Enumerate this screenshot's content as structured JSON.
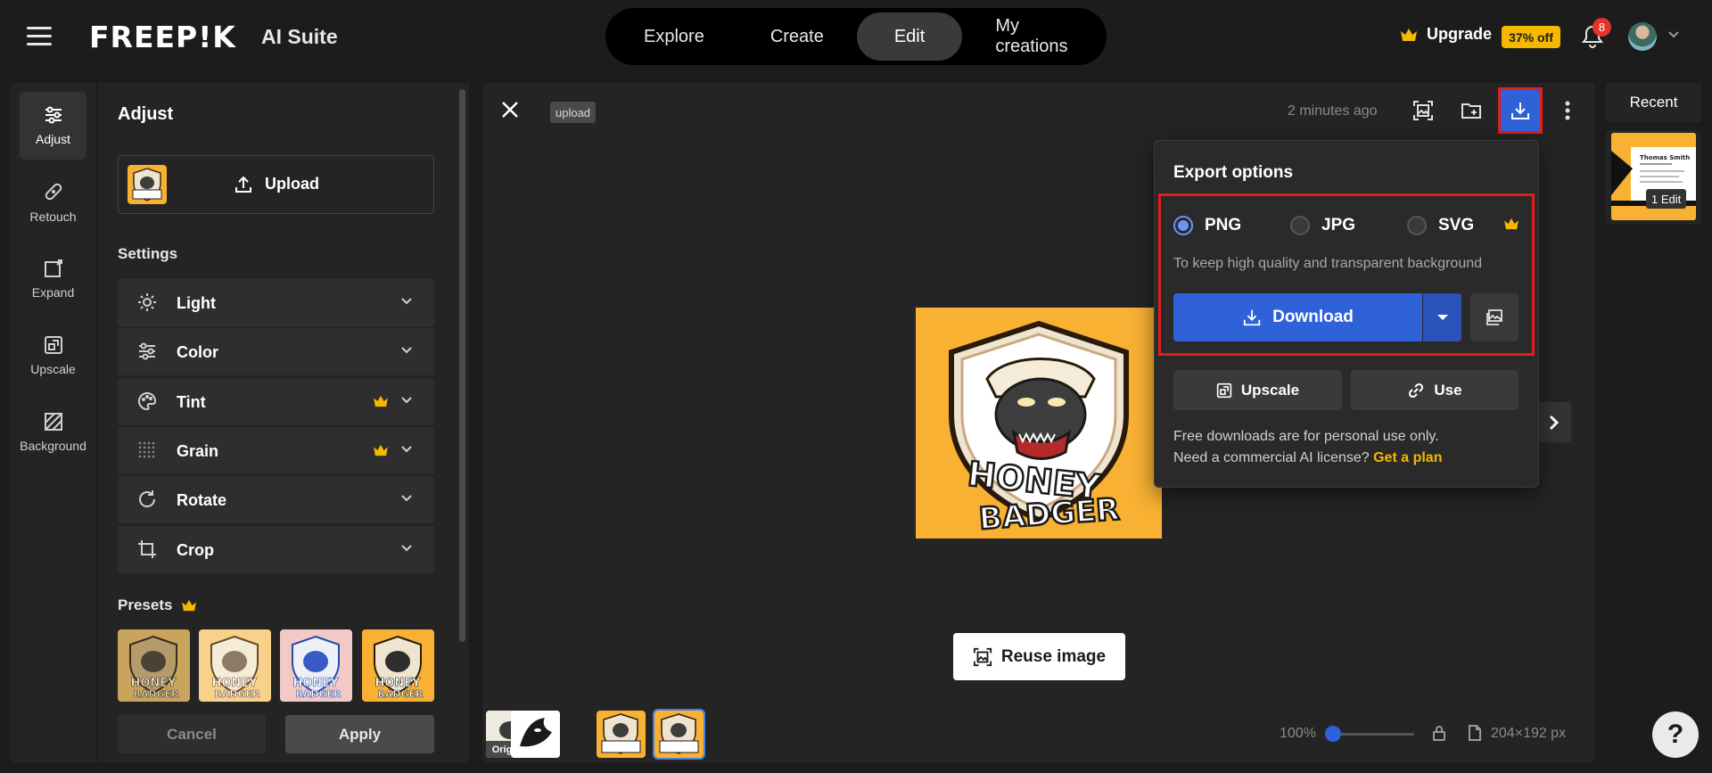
{
  "header": {
    "logo": "FREEP!K",
    "suite": "AI Suite",
    "tabs": [
      {
        "label": "Explore"
      },
      {
        "label": "Create"
      },
      {
        "label": "Edit"
      },
      {
        "label": "My creations"
      }
    ],
    "upgrade_label": "Upgrade",
    "discount_badge": "37% off",
    "notification_count": "8"
  },
  "rail": {
    "items": [
      {
        "label": "Adjust"
      },
      {
        "label": "Retouch"
      },
      {
        "label": "Expand"
      },
      {
        "label": "Upscale"
      },
      {
        "label": "Background"
      }
    ]
  },
  "panel": {
    "title": "Adjust",
    "upload_label": "Upload",
    "settings_title": "Settings",
    "settings": [
      {
        "label": "Light",
        "premium": false
      },
      {
        "label": "Color",
        "premium": false
      },
      {
        "label": "Tint",
        "premium": true
      },
      {
        "label": "Grain",
        "premium": true
      },
      {
        "label": "Rotate",
        "premium": false
      },
      {
        "label": "Crop",
        "premium": false
      }
    ],
    "presets_title": "Presets",
    "cancel_label": "Cancel",
    "apply_label": "Apply"
  },
  "canvas": {
    "tag": "upload",
    "time_ago": "2 minutes ago",
    "reuse_label": "Reuse image",
    "history_original_label": "Original",
    "zoom": "100%",
    "dimensions": "204×192 px",
    "image_text_line1": "HONEY",
    "image_text_line2": "BADGER"
  },
  "export": {
    "title": "Export options",
    "formats": [
      {
        "label": "PNG",
        "selected": true
      },
      {
        "label": "JPG",
        "selected": false
      },
      {
        "label": "SVG",
        "selected": false
      }
    ],
    "hint": "To keep high quality and transparent background",
    "download_label": "Download",
    "upscale_label": "Upscale",
    "use_label": "Use",
    "legal_line1": "Free downloads are for personal use only.",
    "legal_line2": "Need a commercial AI license?",
    "legal_link": "Get a plan"
  },
  "recent": {
    "title": "Recent",
    "badge": "1 Edit",
    "card_name": "Thomas Smith"
  },
  "colors": {
    "accent_blue": "#2f62d9",
    "premium_gold": "#f5b800",
    "highlight_red": "#e01e1e",
    "image_bg": "#f8b133"
  }
}
